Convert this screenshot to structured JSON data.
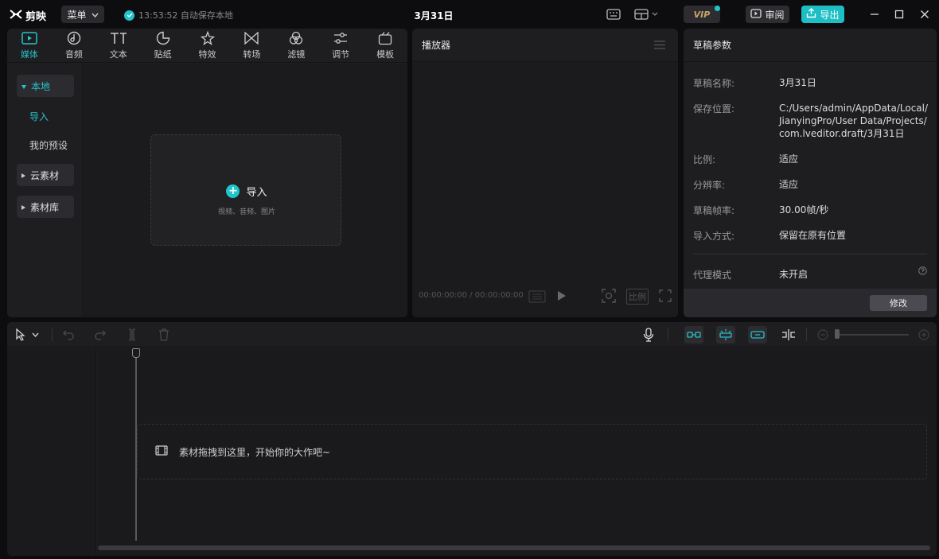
{
  "app": {
    "logo_text": "剪映",
    "menu_label": "菜单",
    "autosave_text": "13:53:52 自动保存本地",
    "project_title": "3月31日",
    "vip_label": "VIP",
    "review_label": "审阅",
    "export_label": "导出"
  },
  "media": {
    "tabs": [
      {
        "label": "媒体",
        "icon": "media-icon",
        "active": true
      },
      {
        "label": "音频",
        "icon": "audio-icon"
      },
      {
        "label": "文本",
        "icon": "text-icon"
      },
      {
        "label": "贴纸",
        "icon": "sticker-icon"
      },
      {
        "label": "特效",
        "icon": "effects-icon"
      },
      {
        "label": "转场",
        "icon": "transition-icon"
      },
      {
        "label": "滤镜",
        "icon": "filter-icon"
      },
      {
        "label": "调节",
        "icon": "adjust-icon"
      },
      {
        "label": "模板",
        "icon": "template-icon"
      }
    ],
    "side": {
      "local": "本地",
      "import": "导入",
      "presets": "我的预设",
      "cloud": "云素材",
      "library": "素材库"
    },
    "import_zone": {
      "label": "导入",
      "hint": "视频、音频、图片"
    }
  },
  "player": {
    "title": "播放器",
    "timecode_current": "00:00:00:00",
    "timecode_separator": "/",
    "timecode_total": "00:00:00:00",
    "ratio_label": "比例"
  },
  "draft": {
    "title": "草稿参数",
    "params": [
      {
        "label": "草稿名称:",
        "value": "3月31日"
      },
      {
        "label": "保存位置:",
        "value": "C:/Users/admin/AppData/Local/JianyingPro/User Data/Projects/com.lveditor.draft/3月31日"
      },
      {
        "label": "比例:",
        "value": "适应"
      },
      {
        "label": "分辨率:",
        "value": "适应"
      },
      {
        "label": "草稿帧率:",
        "value": "30.00帧/秒"
      },
      {
        "label": "导入方式:",
        "value": "保留在原有位置"
      }
    ],
    "proxy_label": "代理模式",
    "proxy_value": "未开启",
    "edit_label": "修改"
  },
  "timeline": {
    "drop_hint": "素材拖拽到这里，开始你的大作吧~"
  },
  "colors": {
    "accent": "#20c4cc",
    "panel": "#1e1e21",
    "background": "#0d0d0f"
  }
}
